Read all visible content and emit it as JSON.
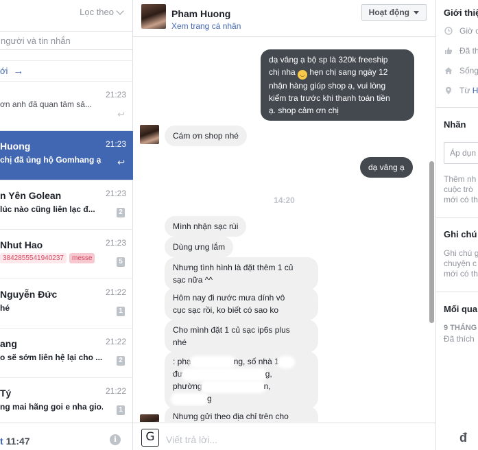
{
  "sidebar": {
    "filter_label": "Lọc theo",
    "search_placeholder": "người và tin nhắn",
    "new_message_label": "ới",
    "conversations": [
      {
        "name": "",
        "time": "21:23",
        "snippet": "ơn anh đã quan tâm sả..."
      },
      {
        "name": "Huong",
        "time": "21:23",
        "snippet": "chị đã ủng hộ Gomhang ạ"
      },
      {
        "name": "n Yên Golean",
        "time": "21:23",
        "snippet": "lúc nào cũng liên lạc đ...",
        "count": "2"
      },
      {
        "name": "Nhut Hao",
        "time": "21:23",
        "tags": [
          "3842855541940237",
          "messe"
        ],
        "count": "5"
      },
      {
        "name": "Nguyễn Đức",
        "time": "21:22",
        "snippet": "hé",
        "count": "1"
      },
      {
        "name": "ang",
        "time": "21:22",
        "snippet": "o sẽ sớm liên hệ lại cho ...",
        "count": "2"
      },
      {
        "name": "Tý",
        "time": "21:22",
        "snippet": "ng mai hãng goi e nha gio...",
        "count": "1"
      }
    ],
    "footer_status_accent": "t",
    "footer_status_time": "11:47"
  },
  "chat": {
    "contact_name": "Pham Huong",
    "profile_link": "Xem trang cá nhân",
    "action_button": "Hoạt động",
    "messages": {
      "m1_a": "dạ vâng ạ bộ sp là 320k freeship",
      "m1_b": "chị nha",
      "m1_c": "hẹn chị sang ngày 12",
      "m1_d": "nhận hàng giúp shop ạ, vui lòng",
      "m1_e": "kiểm tra trước khi thanh toán tiền",
      "m1_f": "ạ. shop cảm ơn chị",
      "m2": "Cám ơn shop nhé",
      "m3": "dạ vâng ạ",
      "timestamp": "14:20",
      "m4": "Mình nhận sạc rùi",
      "m5": "Dùng ưng lắm",
      "m6_a": "Nhưng tình hình là đặt thêm 1 củ",
      "m6_b": "sạc nữa ^^",
      "m7_a": "Hôm nay đi nước mưa dính vô",
      "m7_b": "cục sạc rồi, ko biết có sao ko",
      "m8_a": "Cho mình đặt 1 củ sạc ip6s plus",
      "m8_b": "nhé",
      "m9_a": ": phạ",
      "m9_a2": "ng, số nhà 1",
      "m9_b": "đư",
      "m9_b2": "g,",
      "m9_c": "phường",
      "m9_c2": "n,",
      "m9_d2": "g",
      "m10": "Nhưng gửi theo địa chỉ trên cho"
    },
    "composer_placeholder": "Viết trả lời...",
    "currency_symbol": "đ"
  },
  "info_panel": {
    "intro_title": "Giới thiệ",
    "row1": "Giờ c",
    "row2": "Đã th",
    "row3": "Sống",
    "row4_prefix": "Từ",
    "row4_link": "H",
    "labels_title": "Nhãn",
    "labels_input": "Áp dụn",
    "labels_help_1": "Thêm nh",
    "labels_help_2": "cuộc trò",
    "labels_help_3": "mới có th",
    "notes_title": "Ghi chú",
    "notes_help_1": "Ghi chú g",
    "notes_help_2": "chuyện c",
    "notes_help_3": "mới có th",
    "relation_title": "Mối quan",
    "relation_time": "9 THÁNG",
    "relation_text": "Đã thích"
  }
}
